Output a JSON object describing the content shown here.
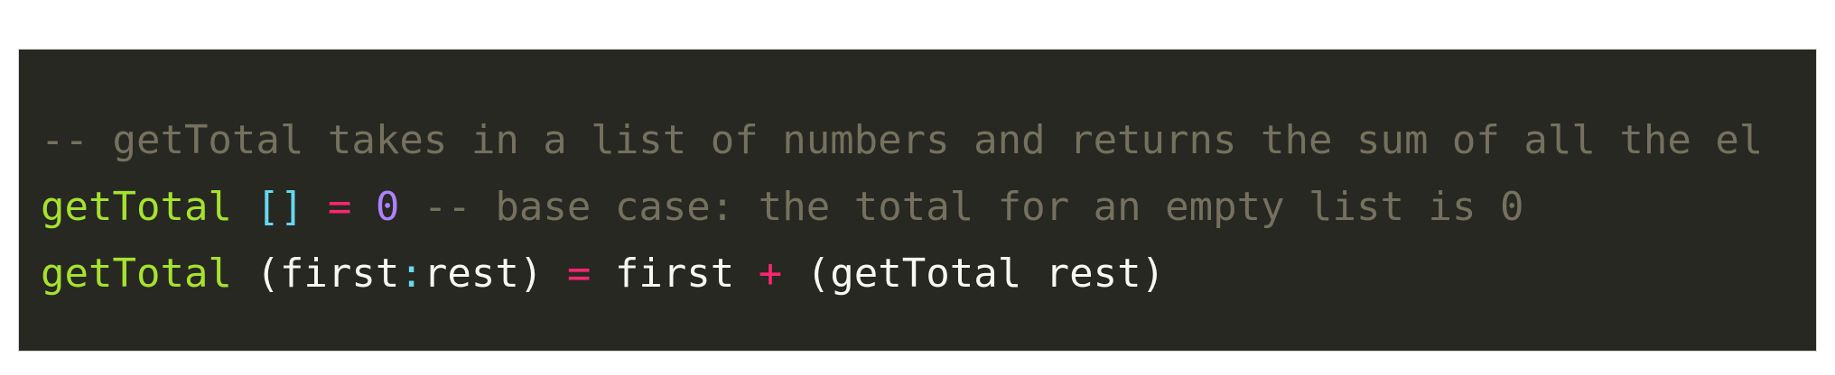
{
  "code_block": {
    "lines": [
      {
        "comment": "-- getTotal takes in a list of numbers and returns the sum of all the el"
      },
      {
        "fn": "getTotal",
        "sp1": " ",
        "empty_list": "[]",
        "sp2": " ",
        "equals": "=",
        "sp3": " ",
        "zero": "0",
        "sp4": " ",
        "comment": "-- base case: the total for an empty list is 0"
      },
      {
        "fn": "getTotal",
        "sp1": " ",
        "open_pattern": "(first",
        "cons": ":",
        "close_pattern": "rest)",
        "sp2": " ",
        "equals": "=",
        "sp3": " ",
        "first": "first",
        "sp4": " ",
        "plus": "+",
        "sp5": " ",
        "recursive_call": "(getTotal rest)"
      }
    ]
  },
  "colors": {
    "background": "#272822",
    "comment": "#75715e",
    "function_name": "#a6e22e",
    "punctuation": "#66d9ef",
    "operator": "#f92672",
    "number": "#ae81ff",
    "text": "#f8f8f2"
  }
}
